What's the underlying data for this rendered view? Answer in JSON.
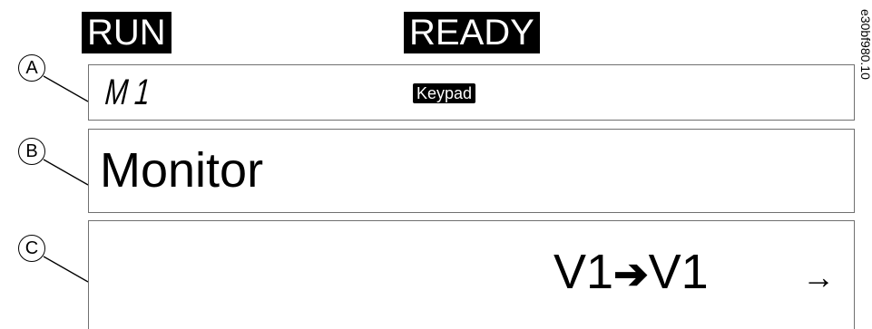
{
  "status": {
    "run": "RUN",
    "ready": "READY"
  },
  "panel_a": {
    "menu_code": "M1",
    "control_place": "Keypad"
  },
  "panel_b": {
    "title": "Monitor"
  },
  "panel_c": {
    "path_from": "V1",
    "path_arrow": "➔",
    "path_to": "V1",
    "next_arrow": "→"
  },
  "callouts": [
    "A",
    "B",
    "C"
  ],
  "document_id": "e30bf980.10"
}
